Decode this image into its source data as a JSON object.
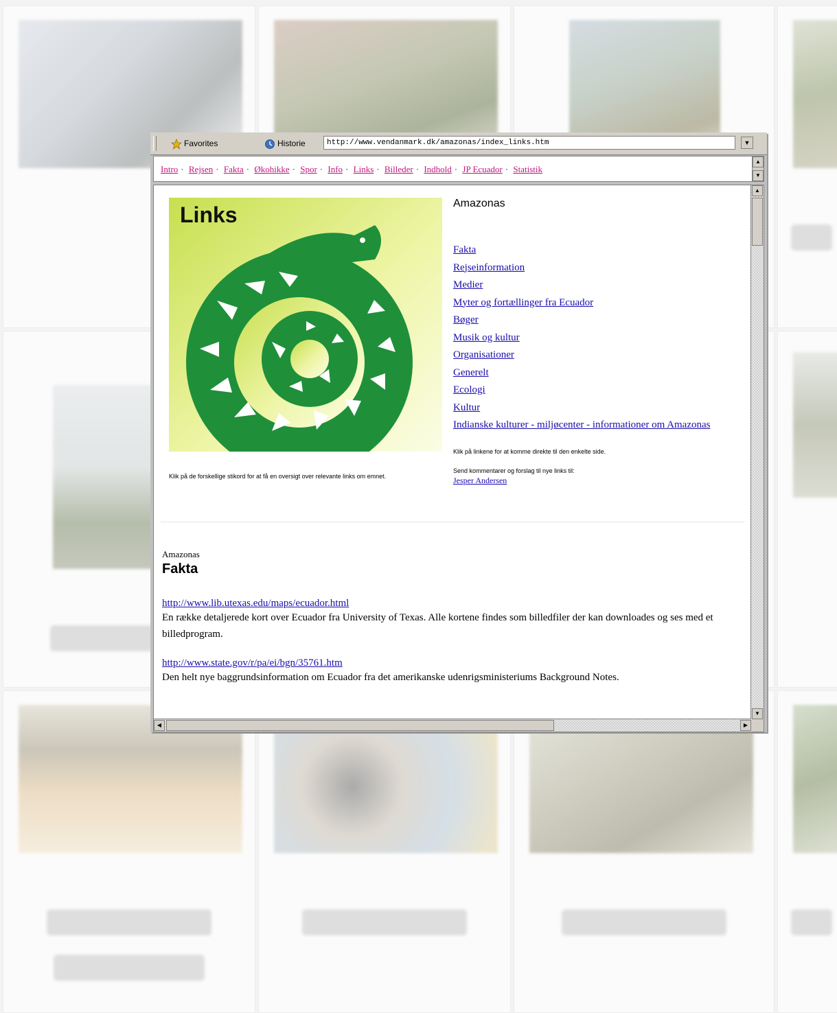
{
  "gallery": {
    "cells": [
      {
        "label": "",
        "pills": []
      },
      {
        "label": "",
        "pills": []
      },
      {
        "label": "",
        "pills": []
      },
      {
        "label": "",
        "pills": []
      },
      {
        "label": "",
        "pills": []
      },
      {
        "label": "",
        "pills": []
      },
      {
        "label": "",
        "pills": []
      },
      {
        "label": "",
        "pills": []
      },
      {
        "label": "",
        "pills": []
      },
      {
        "label": "",
        "pills": []
      },
      {
        "label": "",
        "pills": []
      },
      {
        "label": "",
        "pills": []
      }
    ]
  },
  "browser": {
    "toolbar": {
      "favorites_label": "Favorites",
      "history_label": "Historie",
      "address_value": "http://www.vendanmark.dk/amazonas/index_links.htm"
    },
    "nav": {
      "items": [
        {
          "label": "Intro",
          "color": "#c0157d"
        },
        {
          "label": "Rejsen",
          "color": "#c0157d"
        },
        {
          "label": "Fakta",
          "color": "#c0157d"
        },
        {
          "label": "Økohikke",
          "color": "#c0157d"
        },
        {
          "label": "Spor",
          "color": "#c0157d"
        },
        {
          "label": "Info",
          "color": "#c0157d"
        },
        {
          "label": "Links",
          "color": "#c0157d"
        },
        {
          "label": "Billeder",
          "color": "#c0157d"
        },
        {
          "label": "Indhold",
          "color": "#c0157d"
        },
        {
          "label": "JP Ecuador",
          "color": "#c0157d"
        },
        {
          "label": "Statistik",
          "color": "#c0157d"
        }
      ]
    },
    "banner": {
      "title": "Links",
      "caption": "Klik på de forskellige stikord for at få en oversigt over relevante links om emnet."
    },
    "side": {
      "title": "Amazonas",
      "links": [
        "Fakta",
        "Rejseinformation",
        "Medier",
        "Myter og fortællinger fra Ecuador",
        "Bøger",
        "Musik og kultur",
        "Organisationer",
        "Generelt",
        "Ecologi",
        "Kultur",
        "Indianske kulturer - miljøcenter - informationer om Amazonas"
      ],
      "note": "Klik på linkene for at komme direkte til den enkelte side.",
      "note2": "Send kommentarer og forslag til nye links til:",
      "note_link": "Jesper Andersen"
    },
    "main": {
      "kicker": "Amazonas",
      "heading": "Fakta",
      "entries": [
        {
          "link": "http://www.lib.utexas.edu/maps/ecuador.html",
          "text": "En række detaljerede kort over Ecuador fra University of Texas. Alle kortene findes som billedfiler der kan downloades og ses med et billedprogram."
        },
        {
          "link": "http://www.state.gov/r/pa/ei/bgn/35761.htm",
          "text": "Den helt nye baggrundsinformation om Ecuador fra det amerikanske udenrigsministeriums Background Notes."
        }
      ]
    }
  }
}
